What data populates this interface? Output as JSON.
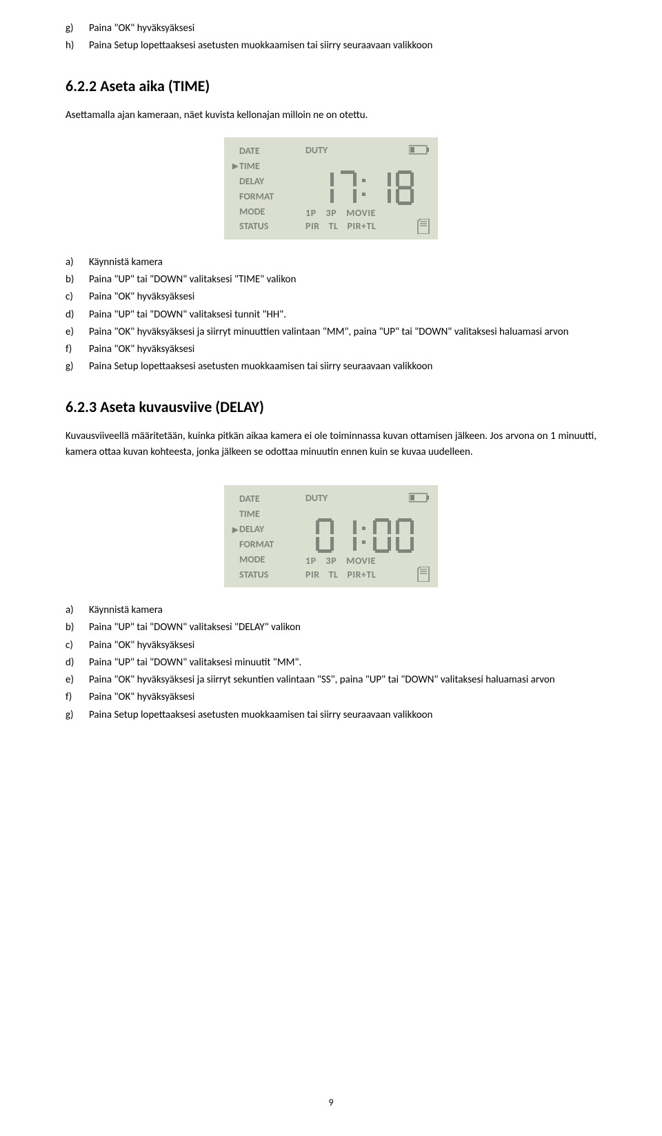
{
  "list_top": {
    "g": "Paina \"OK\" hyväksyäksesi",
    "h": "Paina Setup lopettaaksesi asetusten muokkaamisen tai siirry seuraavaan valikkoon"
  },
  "sec_time": {
    "heading": "6.2.2  Aseta aika (TIME)",
    "intro": "Asettamalla ajan kameraan, näet kuvista kellonajan milloin ne on otettu.",
    "steps": {
      "a": "Käynnistä kamera",
      "b": "Paina \"UP\" tai \"DOWN\" valitaksesi \"TIME\" valikon",
      "c": "Paina \"OK\" hyväksyäksesi",
      "d": "Paina \"UP\" tai \"DOWN\" valitaksesi tunnit \"HH\".",
      "e": "Paina \"OK\" hyväksyäksesi ja siirryt minuuttien valintaan \"MM\", paina \"UP\" tai \"DOWN\" valitaksesi haluamasi arvon",
      "f": "Paina \"OK\" hyväksyäksesi",
      "g": "Paina Setup lopettaaksesi asetusten muokkaamisen tai siirry seuraavaan valikkoon"
    }
  },
  "sec_delay": {
    "heading": "6.2.3  Aseta kuvausviive (DELAY)",
    "intro": "Kuvausviiveellä määritetään, kuinka pitkän aikaa kamera ei ole toiminnassa kuvan ottamisen jälkeen. Jos arvona on 1 minuutti, kamera ottaa kuvan kohteesta, jonka jälkeen se odottaa minuutin ennen kuin se kuvaa uudelleen.",
    "steps": {
      "a": "Käynnistä kamera",
      "b": "Paina \"UP\" tai \"DOWN\" valitaksesi \"DELAY\" valikon",
      "c": "Paina \"OK\" hyväksyäksesi",
      "d": "Paina \"UP\" tai \"DOWN\" valitaksesi minuutit \"MM\".",
      "e": "Paina \"OK\" hyväksyäksesi ja siirryt sekuntien valintaan \"SS\", paina \"UP\" tai \"DOWN\" valitaksesi haluamasi arvon",
      "f": "Paina \"OK\" hyväksyäksesi",
      "g": "Paina Setup lopettaaksesi asetusten muokkaamisen tai siirry seuraavaan valikkoon"
    }
  },
  "lcd": {
    "menu": [
      "DATE",
      "TIME",
      "DELAY",
      "FORMAT",
      "MODE",
      "STATUS"
    ],
    "duty": "DUTY",
    "row1": [
      "1P",
      "3P",
      "MOVIE"
    ],
    "row2": [
      "PIR",
      "TL",
      "PIR+TL"
    ]
  },
  "lcd1_selected": "TIME",
  "lcd2_selected": "DELAY",
  "page_number": "9"
}
